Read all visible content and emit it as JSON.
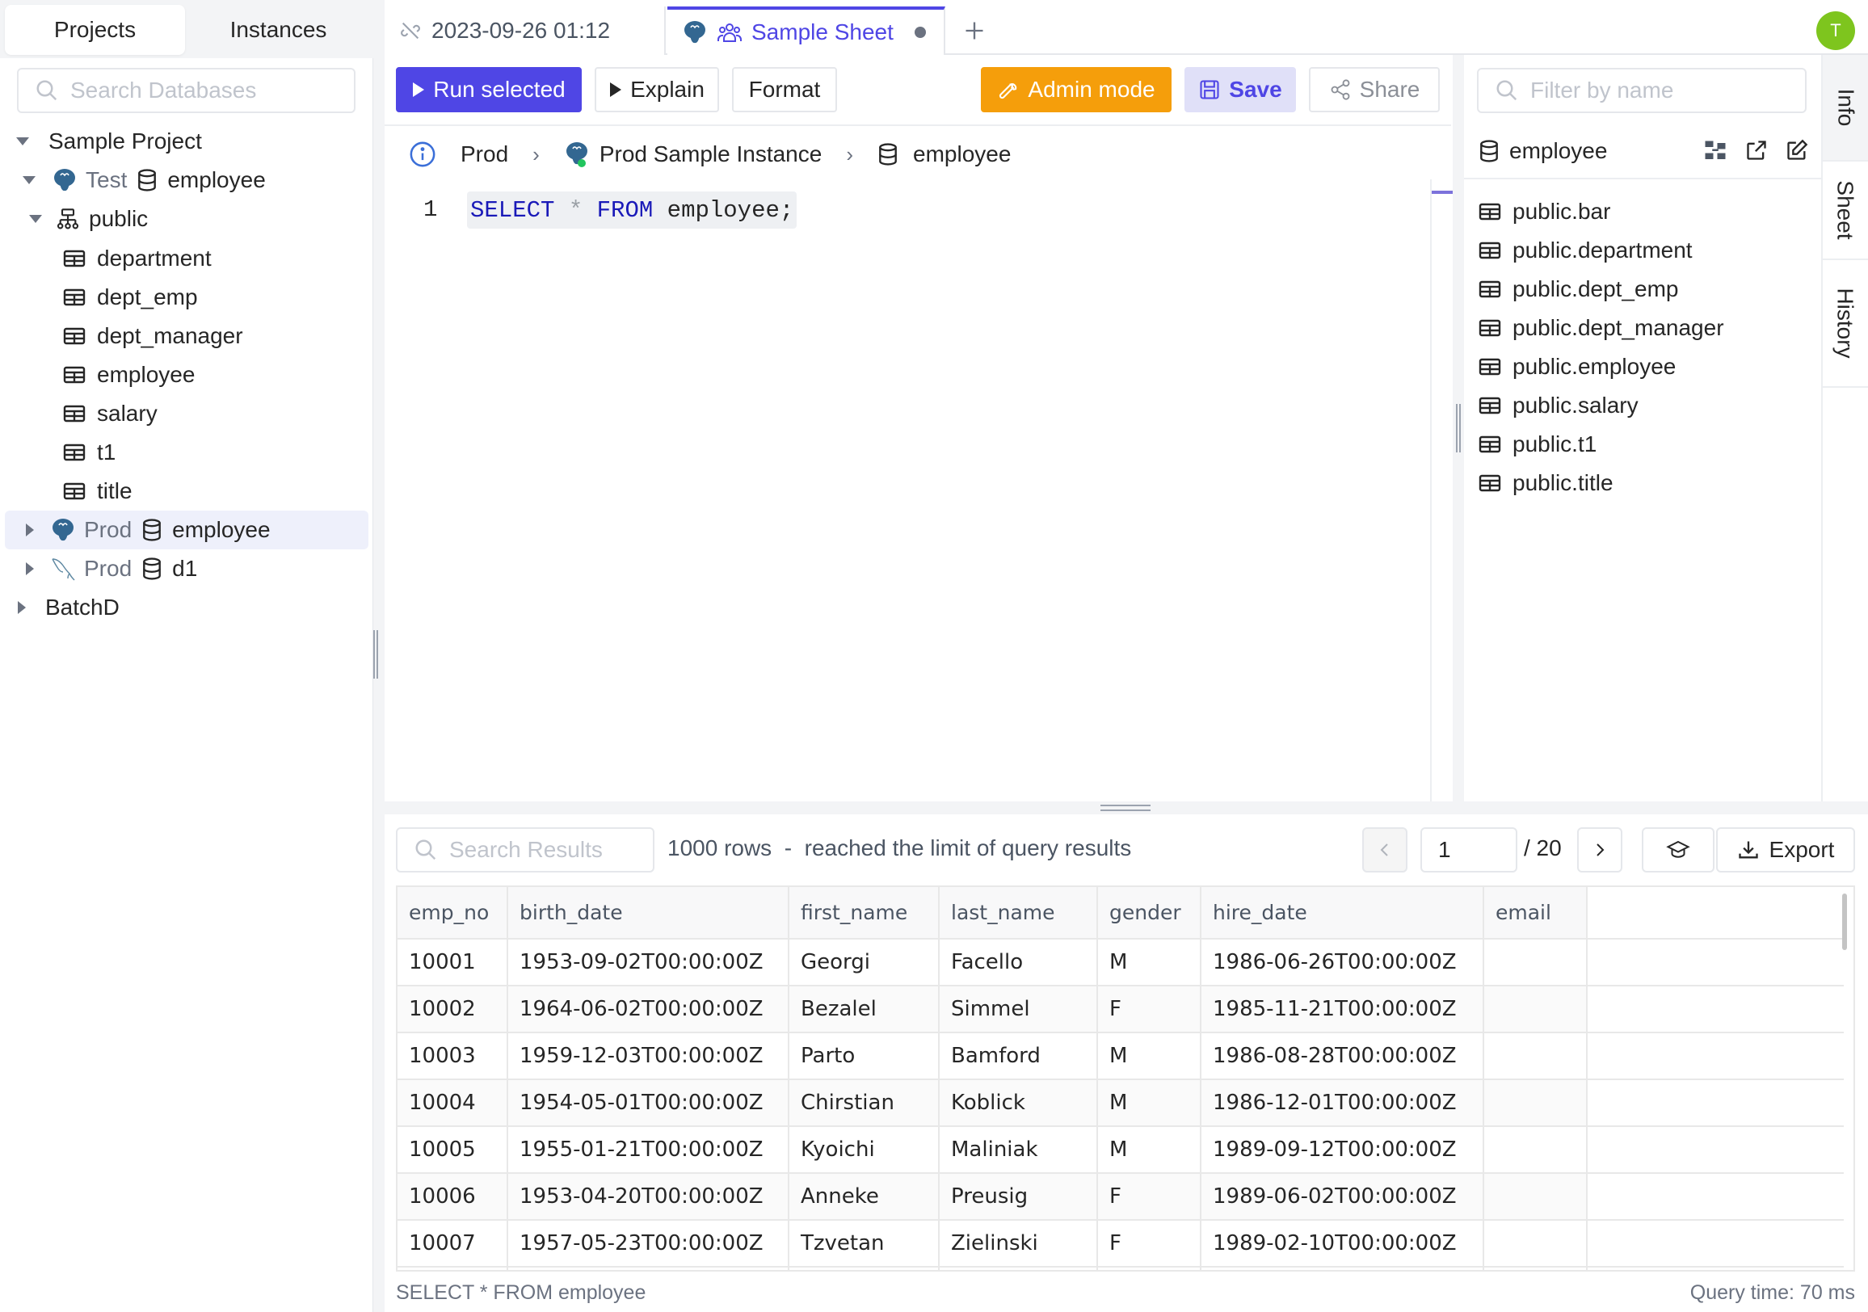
{
  "sidebar": {
    "tabs": [
      "Projects",
      "Instances"
    ],
    "active_tab": "Projects",
    "search_placeholder": "Search Databases",
    "tree": {
      "project": "Sample Project",
      "test_db": {
        "env": "Test",
        "database": "employee",
        "engine_icon": "postgres-icon"
      },
      "schema": "public",
      "tables": [
        "department",
        "dept_emp",
        "dept_manager",
        "employee",
        "salary",
        "t1",
        "title"
      ],
      "prod_db": {
        "env": "Prod",
        "database": "employee",
        "engine_icon": "postgres-icon",
        "selected": true
      },
      "prod_db2": {
        "env": "Prod",
        "database": "d1",
        "engine_icon": "mysql-icon"
      },
      "other_project": "BatchD"
    }
  },
  "tabs": [
    {
      "label": "2023-09-26 01:12",
      "icon": "unlink-icon",
      "active": false
    },
    {
      "label": "Sample Sheet",
      "icon": "users-icon",
      "engine_icon": "postgres-icon",
      "active": true,
      "unsaved": true
    }
  ],
  "avatar": {
    "initial": "T",
    "color": "#7ec51e"
  },
  "toolbar": {
    "run_label": "Run selected",
    "explain_label": "Explain",
    "format_label": "Format",
    "admin_label": "Admin mode",
    "save_label": "Save",
    "share_label": "Share"
  },
  "breadcrumb": {
    "environment": "Prod",
    "instance": "Prod Sample Instance",
    "database": "employee"
  },
  "editor": {
    "line_number": "1",
    "tokens": {
      "kw1": "SELECT",
      "op": " * ",
      "kw2": "FROM",
      "rest": " employee;"
    }
  },
  "right_panel": {
    "filter_placeholder": "Filter by name",
    "database": "employee",
    "tables": [
      "public.bar",
      "public.department",
      "public.dept_emp",
      "public.dept_manager",
      "public.employee",
      "public.salary",
      "public.t1",
      "public.title"
    ],
    "vertical_tabs": [
      "Info",
      "Sheet",
      "History"
    ],
    "active_vertical_tab": "Info"
  },
  "results": {
    "search_placeholder": "Search Results",
    "row_info": "1000 rows  -  reached the limit of query results",
    "page": "1",
    "page_total": "/ 20",
    "export_label": "Export",
    "columns": [
      "emp_no",
      "birth_date",
      "first_name",
      "last_name",
      "gender",
      "hire_date",
      "email"
    ],
    "rows": [
      [
        "10001",
        "1953-09-02T00:00:00Z",
        "Georgi",
        "Facello",
        "M",
        "1986-06-26T00:00:00Z",
        ""
      ],
      [
        "10002",
        "1964-06-02T00:00:00Z",
        "Bezalel",
        "Simmel",
        "F",
        "1985-11-21T00:00:00Z",
        ""
      ],
      [
        "10003",
        "1959-12-03T00:00:00Z",
        "Parto",
        "Bamford",
        "M",
        "1986-08-28T00:00:00Z",
        ""
      ],
      [
        "10004",
        "1954-05-01T00:00:00Z",
        "Chirstian",
        "Koblick",
        "M",
        "1986-12-01T00:00:00Z",
        ""
      ],
      [
        "10005",
        "1955-01-21T00:00:00Z",
        "Kyoichi",
        "Maliniak",
        "M",
        "1989-09-12T00:00:00Z",
        ""
      ],
      [
        "10006",
        "1953-04-20T00:00:00Z",
        "Anneke",
        "Preusig",
        "F",
        "1989-06-02T00:00:00Z",
        ""
      ],
      [
        "10007",
        "1957-05-23T00:00:00Z",
        "Tzvetan",
        "Zielinski",
        "F",
        "1989-02-10T00:00:00Z",
        ""
      ]
    ],
    "status_sql": "SELECT * FROM employee",
    "query_time": "Query time: 70 ms"
  }
}
